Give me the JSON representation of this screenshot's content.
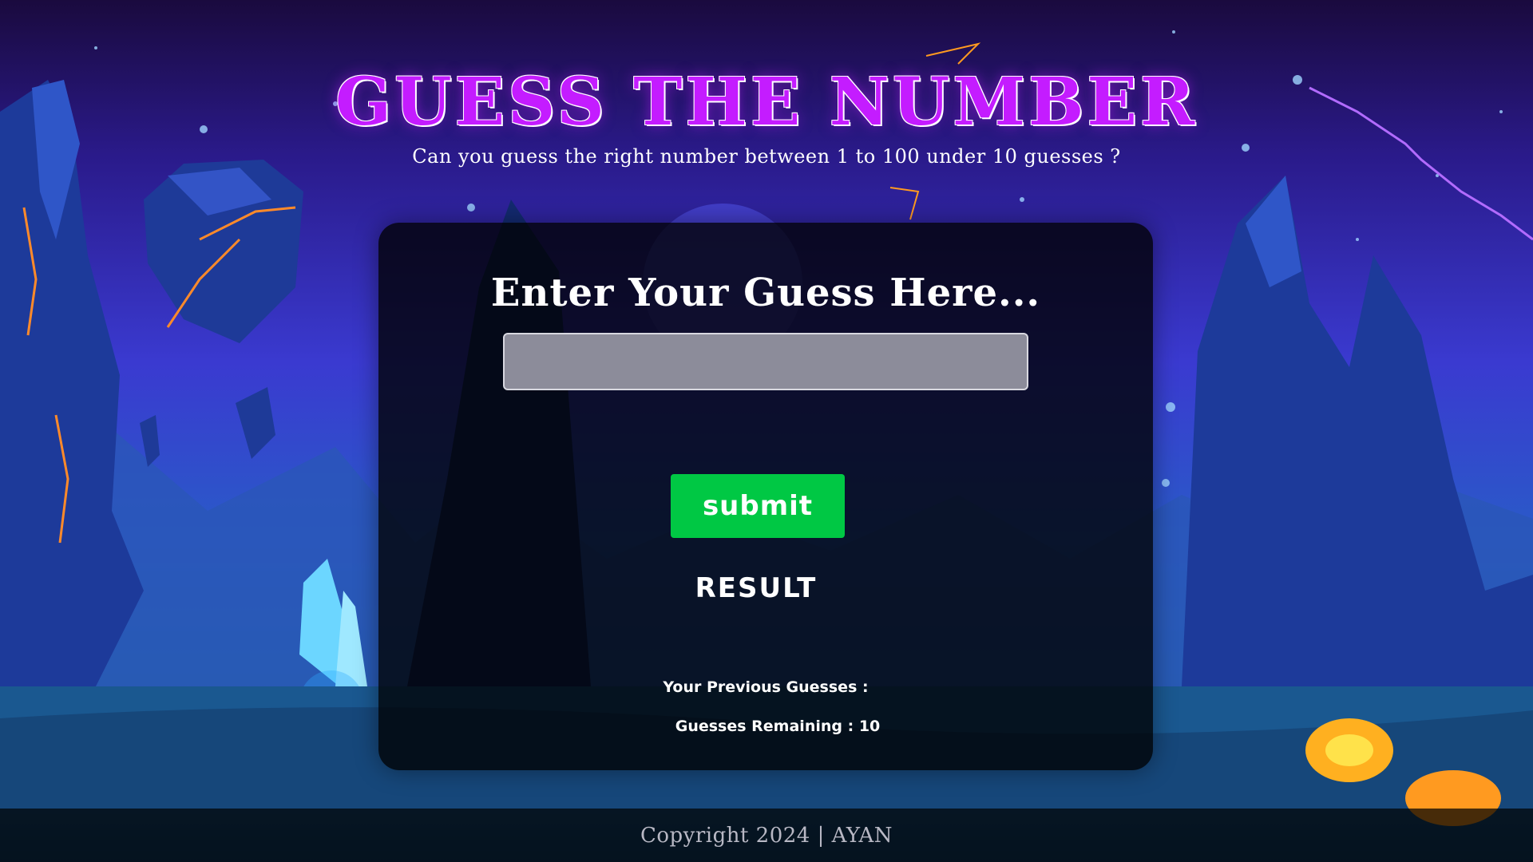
{
  "header": {
    "title": "GUESS THE NUMBER",
    "subtitle": "Can you guess the right number between 1 to 100 under 10 guesses ?"
  },
  "game": {
    "prompt": "Enter Your Guess Here...",
    "input_value": "",
    "submit_label": "submit",
    "result_label": "RESULT",
    "previous_guesses_label": "Your Previous Guesses :",
    "remaining_label": "Guesses Remaining : 10"
  },
  "footer": {
    "text": "Copyright 2024 | AYAN"
  },
  "colors": {
    "title": "#c41cff",
    "submit_button": "#00c844",
    "card_background": "#000000",
    "input_background": "#8c8c9a"
  }
}
